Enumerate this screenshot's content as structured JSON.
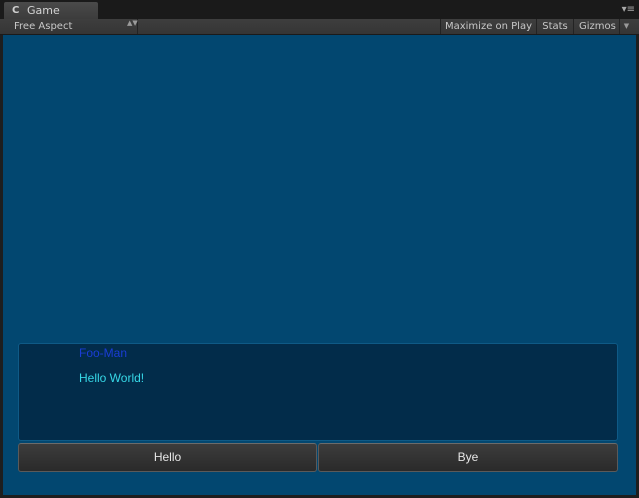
{
  "tab": {
    "icon": "unity-game-icon",
    "label": "Game"
  },
  "window_menu": {
    "icon": "window-menu-icon",
    "glyph": "▾≡"
  },
  "toolbar": {
    "aspect_label": "Free Aspect",
    "aspect_arrows": "▲▼",
    "maximize_label": "Maximize on Play",
    "stats_label": "Stats",
    "gizmos_label": "Gizmos",
    "gizmos_arrow": "▼"
  },
  "game": {
    "background_color": "#024770",
    "dialogue": {
      "speaker": "Foo-Man",
      "text": "Hello World!",
      "speaker_color": "#1a3dd6",
      "text_color": "#36d7e6"
    },
    "choices": [
      {
        "label": "Hello"
      },
      {
        "label": "Bye"
      }
    ]
  }
}
